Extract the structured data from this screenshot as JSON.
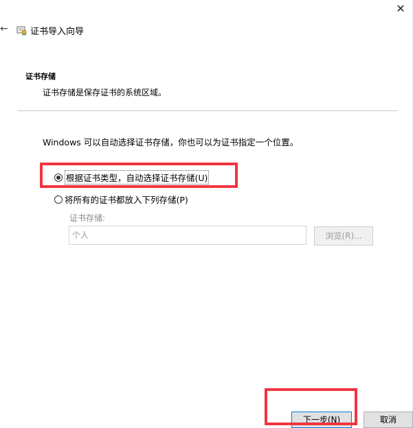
{
  "window": {
    "title": "证书导入向导",
    "close_glyph": "✕",
    "back_glyph": "←"
  },
  "section": {
    "title": "证书存储",
    "description": "证书存储是保存证书的系统区域。"
  },
  "intro_text": "Windows 可以自动选择证书存储，你也可以为证书指定一个位置。",
  "options": [
    {
      "label": "根据证书类型，自动选择证书存储(U)",
      "selected": true
    },
    {
      "label": "将所有的证书都放入下列存储(P)",
      "selected": false
    }
  ],
  "store": {
    "label": "证书存储:",
    "value": "个人",
    "browse_label": "浏览(R)..."
  },
  "buttons": {
    "next_label": "下一步(N)",
    "cancel_label": "取消"
  },
  "colors": {
    "highlight_box": "#f2353f",
    "default_button_border": "#0078d7"
  }
}
